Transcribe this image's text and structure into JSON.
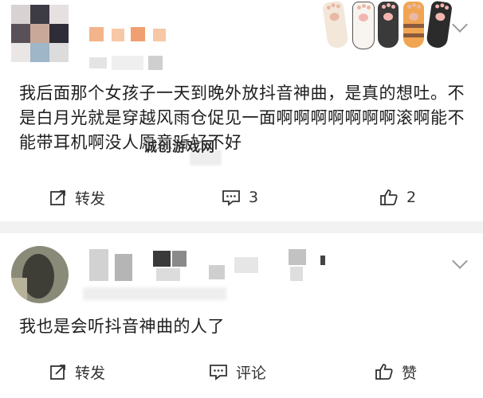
{
  "posts": [
    {
      "text": "我后面那个女孩子一天到晚外放抖音神曲，是真的想吐。不是白月光就是穿越风雨仓促见一面啊啊啊啊啊啊啊滚啊能不能带耳机啊没人愿意听好不好",
      "watermark": "诚创游戏网",
      "actions": {
        "repost": "转发",
        "comments": "3",
        "likes": "2"
      }
    },
    {
      "text": "我也是会听抖音神曲的人了",
      "actions": {
        "repost": "转发",
        "comment": "评论",
        "like": "赞"
      }
    }
  ],
  "colors": {
    "background": "#ffffff",
    "separator": "#f2f2f2",
    "icon": "#333333",
    "muted": "#9a9a9a",
    "accent_orange": "#f0a070"
  },
  "icons": [
    "repost-icon",
    "comment-icon",
    "thumbs-up-icon",
    "chevron-down-icon",
    "cat-paw-sticker-icon"
  ]
}
